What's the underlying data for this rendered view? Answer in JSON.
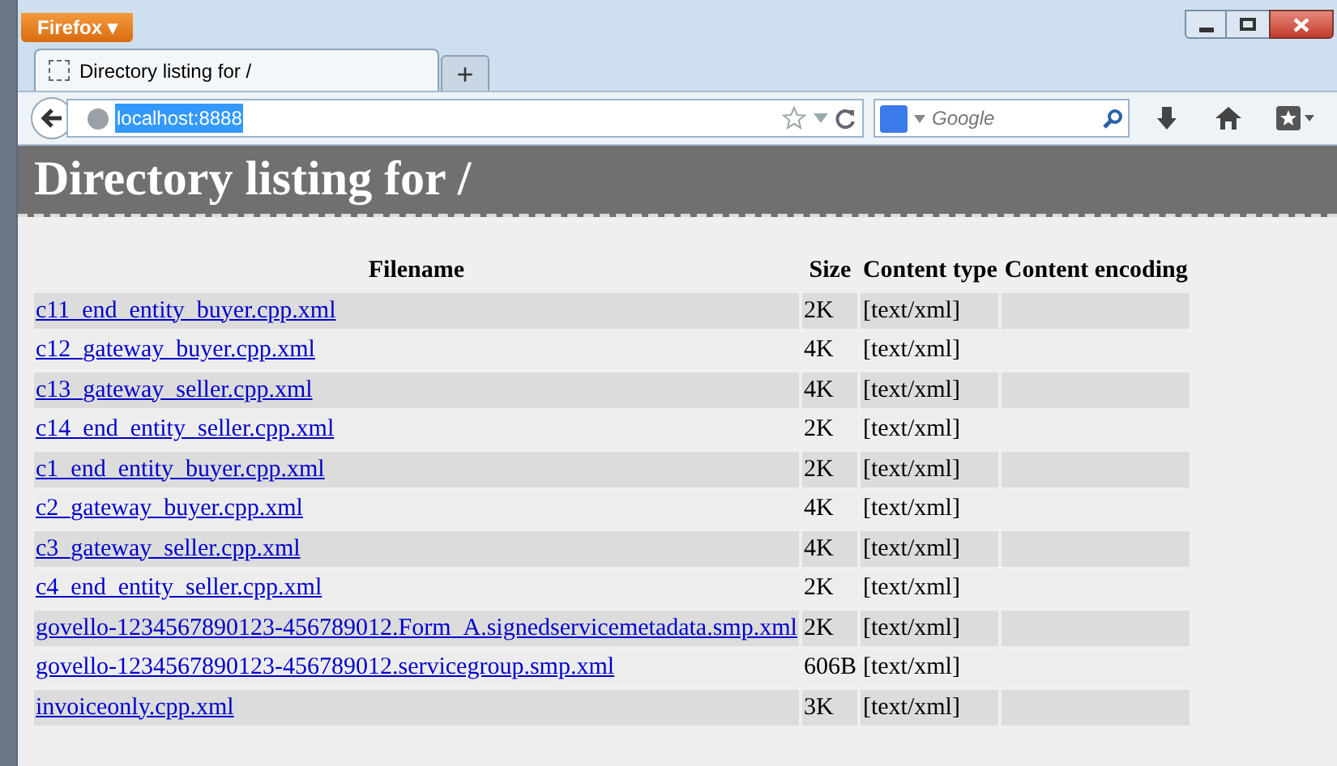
{
  "browser": {
    "menu_button": "Firefox ▾",
    "tabs": [
      {
        "label": "Directory listing for /",
        "selected": true
      }
    ],
    "new_tab": "+",
    "address": "localhost:8888",
    "search_placeholder": "Google"
  },
  "page": {
    "heading": "Directory listing for /",
    "table": {
      "columns": [
        "Filename",
        "Size",
        "Content type",
        "Content encoding"
      ],
      "rows": [
        {
          "filename": "c11_end_entity_buyer.cpp.xml",
          "size": "2K",
          "type": "[text/xml]"
        },
        {
          "filename": "c12_gateway_buyer.cpp.xml",
          "size": "4K",
          "type": "[text/xml]"
        },
        {
          "filename": "c13_gateway_seller.cpp.xml",
          "size": "4K",
          "type": "[text/xml]"
        },
        {
          "filename": "c14_end_entity_seller.cpp.xml",
          "size": "2K",
          "type": "[text/xml]"
        },
        {
          "filename": "c1_end_entity_buyer.cpp.xml",
          "size": "2K",
          "type": "[text/xml]"
        },
        {
          "filename": "c2_gateway_buyer.cpp.xml",
          "size": "4K",
          "type": "[text/xml]"
        },
        {
          "filename": "c3_gateway_seller.cpp.xml",
          "size": "4K",
          "type": "[text/xml]"
        },
        {
          "filename": "c4_end_entity_seller.cpp.xml",
          "size": "2K",
          "type": "[text/xml]"
        },
        {
          "filename": "govello-1234567890123-456789012.Form_A.signedservicemetadata.smp.xml",
          "size": "2K",
          "type": "[text/xml]"
        },
        {
          "filename": "govello-1234567890123-456789012.servicegroup.smp.xml",
          "size": "606B",
          "type": "[text/xml]"
        },
        {
          "filename": "invoiceonly.cpp.xml",
          "size": "3K",
          "type": "[text/xml]"
        }
      ]
    }
  }
}
